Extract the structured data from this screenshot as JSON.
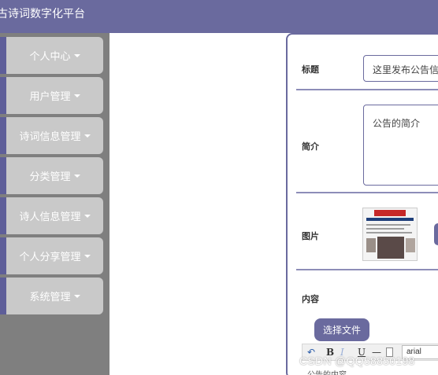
{
  "app": {
    "title": "古诗词数字化平台"
  },
  "sidebar": {
    "items": [
      {
        "label": "个人中心"
      },
      {
        "label": "用户管理"
      },
      {
        "label": "诗词信息管理"
      },
      {
        "label": "分类管理"
      },
      {
        "label": "诗人信息管理"
      },
      {
        "label": "个人分享管理"
      },
      {
        "label": "系统管理"
      }
    ]
  },
  "form": {
    "title_label": "标题",
    "title_value": "这里发布公告信",
    "summary_label": "简介",
    "summary_value": "公告的简介",
    "image_label": "图片",
    "content_label": "内容",
    "choose_file_label": "选择文件",
    "editor": {
      "bold": "B",
      "italic": "I",
      "underline": "U",
      "hr": "—",
      "font_value": "arial",
      "peek_text": "公告的内容"
    }
  },
  "watermark": "CSDN @QQ58850198",
  "colors": {
    "header_bg": "#6a6a9e",
    "sidebar_bg": "#7f7f7f",
    "menu_item_bg": "#c9c9c9",
    "accent": "#5e5e99"
  }
}
